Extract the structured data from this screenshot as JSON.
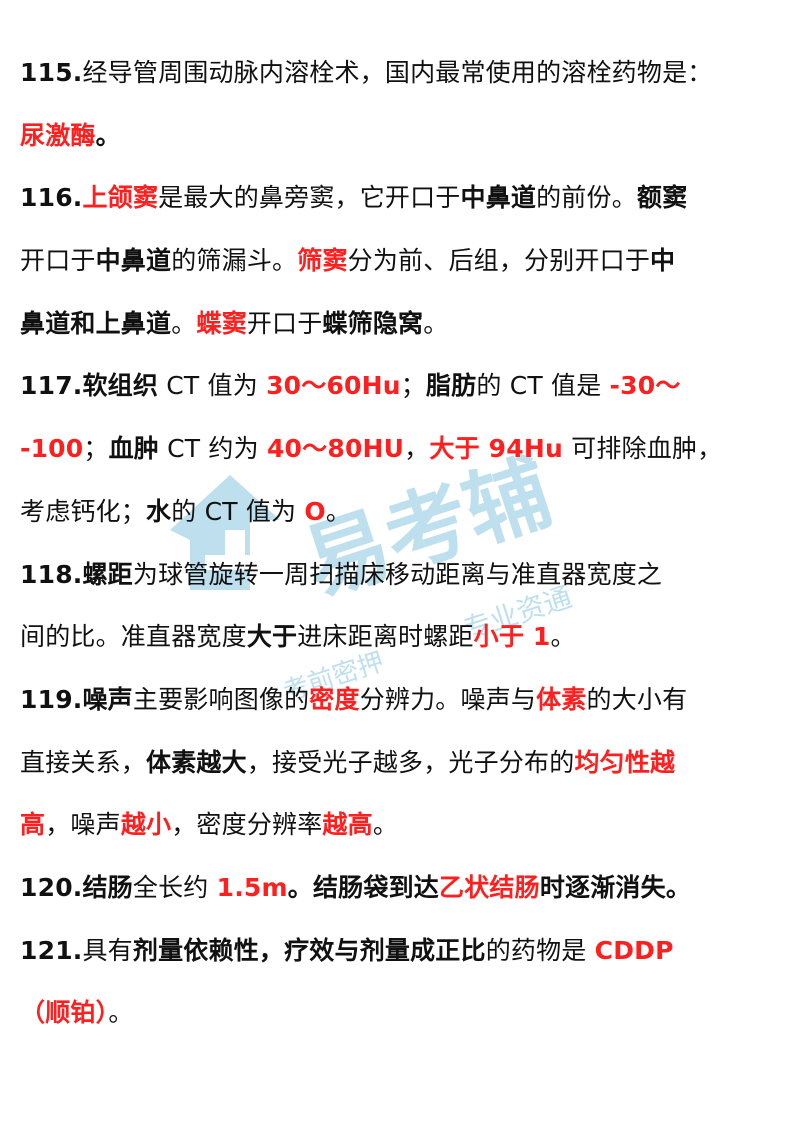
{
  "watermark": {
    "brand": "易考辅",
    "slogan": "专业资通",
    "slogan2": "考前密押",
    "color": "#1a8fc2"
  },
  "colors": {
    "text": "#111111",
    "highlight": "#ff1f1f"
  },
  "lines": [
    [
      {
        "t": "115.",
        "s": "b"
      },
      {
        "t": "经导管周围动脉内溶栓术，国内最常使用的溶栓药物是：",
        "s": ""
      }
    ],
    [
      {
        "t": "尿激酶",
        "s": "r"
      },
      {
        "t": "。",
        "s": "b"
      }
    ],
    [
      {
        "t": "116.",
        "s": "b"
      },
      {
        "t": "上颌窦",
        "s": "r"
      },
      {
        "t": "是最大的鼻旁窦，它开口于",
        "s": ""
      },
      {
        "t": "中鼻道",
        "s": "b"
      },
      {
        "t": "的前份。",
        "s": ""
      },
      {
        "t": "额窦",
        "s": "b"
      }
    ],
    [
      {
        "t": "开口于",
        "s": ""
      },
      {
        "t": "中鼻道",
        "s": "b"
      },
      {
        "t": "的筛漏斗。",
        "s": ""
      },
      {
        "t": "筛窦",
        "s": "r"
      },
      {
        "t": "分为前、后组，分别开口于",
        "s": ""
      },
      {
        "t": "中",
        "s": "b"
      }
    ],
    [
      {
        "t": "鼻道和上鼻道",
        "s": "b"
      },
      {
        "t": "。",
        "s": ""
      },
      {
        "t": "蝶窦",
        "s": "r"
      },
      {
        "t": "开口于",
        "s": ""
      },
      {
        "t": "蝶筛隐窝",
        "s": "b"
      },
      {
        "t": "。",
        "s": ""
      }
    ],
    [
      {
        "t": "117.",
        "s": "b"
      },
      {
        "t": "软组织",
        "s": "b"
      },
      {
        "t": " CT 值为 ",
        "s": ""
      },
      {
        "t": "30～60Hu",
        "s": "r"
      },
      {
        "t": "；",
        "s": ""
      },
      {
        "t": "脂肪",
        "s": "b"
      },
      {
        "t": "的 CT 值是 ",
        "s": ""
      },
      {
        "t": "-30～",
        "s": "r"
      }
    ],
    [
      {
        "t": "-100",
        "s": "r"
      },
      {
        "t": "；",
        "s": ""
      },
      {
        "t": "血肿",
        "s": "b"
      },
      {
        "t": " CT 约为 ",
        "s": ""
      },
      {
        "t": "40～80HU",
        "s": "r"
      },
      {
        "t": "，",
        "s": ""
      },
      {
        "t": "大于 94Hu",
        "s": "r"
      },
      {
        "t": " 可排除血肿，",
        "s": ""
      }
    ],
    [
      {
        "t": "考虑钙化；",
        "s": ""
      },
      {
        "t": "水",
        "s": "b"
      },
      {
        "t": "的 CT 值为 ",
        "s": ""
      },
      {
        "t": "O",
        "s": "r"
      },
      {
        "t": "。",
        "s": ""
      }
    ],
    [
      {
        "t": "118.",
        "s": "b"
      },
      {
        "t": "螺距",
        "s": "b"
      },
      {
        "t": "为球管旋转一周扫描床移动距离与准直器宽度之",
        "s": ""
      }
    ],
    [
      {
        "t": "间的比。准直器宽度",
        "s": ""
      },
      {
        "t": "大于",
        "s": "b"
      },
      {
        "t": "进床距离时螺距",
        "s": ""
      },
      {
        "t": "小于 1",
        "s": "r"
      },
      {
        "t": "。",
        "s": ""
      }
    ],
    [
      {
        "t": "119.",
        "s": "b"
      },
      {
        "t": "噪声",
        "s": "b"
      },
      {
        "t": "主要影响图像的",
        "s": ""
      },
      {
        "t": "密度",
        "s": "r"
      },
      {
        "t": "分辨力。噪声与",
        "s": ""
      },
      {
        "t": "体素",
        "s": "r"
      },
      {
        "t": "的大小有",
        "s": ""
      }
    ],
    [
      {
        "t": "直接关系，",
        "s": ""
      },
      {
        "t": "体素越大",
        "s": "b"
      },
      {
        "t": "，接受光子越多，光子分布的",
        "s": ""
      },
      {
        "t": "均匀性越",
        "s": "r"
      }
    ],
    [
      {
        "t": "高",
        "s": "r"
      },
      {
        "t": "，噪声",
        "s": ""
      },
      {
        "t": "越小",
        "s": "r"
      },
      {
        "t": "，密度分辨率",
        "s": ""
      },
      {
        "t": "越高",
        "s": "r"
      },
      {
        "t": "。",
        "s": ""
      }
    ],
    [
      {
        "t": "120.",
        "s": "b"
      },
      {
        "t": "结肠",
        "s": "b"
      },
      {
        "t": "全长约 ",
        "s": ""
      },
      {
        "t": "1.5m",
        "s": "r"
      },
      {
        "t": "。",
        "s": "b"
      },
      {
        "t": "结肠袋到达",
        "s": "b"
      },
      {
        "t": "乙状结肠",
        "s": "r"
      },
      {
        "t": "时逐渐消失。",
        "s": "b"
      }
    ],
    [
      {
        "t": "121.",
        "s": "b"
      },
      {
        "t": "具有",
        "s": ""
      },
      {
        "t": "剂量依赖性，疗效与剂量成正比",
        "s": "b"
      },
      {
        "t": "的药物是 ",
        "s": ""
      },
      {
        "t": "CDDP",
        "s": "r"
      }
    ],
    [
      {
        "t": "（顺铂）",
        "s": "r"
      },
      {
        "t": "。",
        "s": ""
      }
    ]
  ]
}
